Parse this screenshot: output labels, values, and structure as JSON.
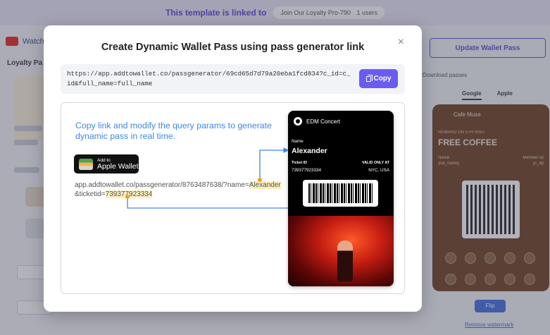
{
  "background": {
    "banner_text": "This template is linked to",
    "banner_pill": "Join Our Loyalty Pro-790",
    "banner_count": "1 users",
    "youtube_label": "Watch",
    "section_label": "Loyalty Pa",
    "update_button": "Update Wallet Pass",
    "download_label": "Download passes",
    "tabs": [
      "Google",
      "Apple"
    ],
    "card": {
      "name": "Cafe Muse",
      "reward_label": "REWARD ON 5TH VISIT",
      "reward_value": "FREE COFFEE",
      "left_label": "Name",
      "left_value": "{full_name}",
      "right_label": "Member ID",
      "right_value": "{c_id}"
    },
    "flip_button": "Flip",
    "remove_watermark": "Remove watermark"
  },
  "modal": {
    "title": "Create Dynamic Wallet Pass using pass generator link",
    "link_url": "https://app.addtowallet.co/passgenerator/69cd65d7d79a20eba1fcd834?c_id=c_id&full_name=full_name",
    "copy_label": "Copy",
    "close_icon": "×",
    "illustration": {
      "instruction": "Copy link and modify the query params to generate dynamic pass in real time.",
      "wallet_btn_small": "Add to",
      "wallet_btn_large": "Apple Wallet",
      "sample_prefix": "app.addtowallet.co/passgenerator/8763487638/?name=",
      "sample_name": "Alexander",
      "sample_mid": "&ticketid=",
      "sample_ticket": "739377923334",
      "pass": {
        "event": "EDM Concert",
        "name_label": "Name",
        "name_value": "Alexander",
        "ticket_label": "Ticket ID",
        "ticket_value": "739377923334",
        "valid_label": "VALID ONLY AT",
        "valid_value": "NYC, USA"
      }
    },
    "colors": {
      "accent": "#6a5cf0",
      "instruction_text": "#3f86e8",
      "highlight": "#fbeebc",
      "arrow": "#3f86e8"
    }
  }
}
